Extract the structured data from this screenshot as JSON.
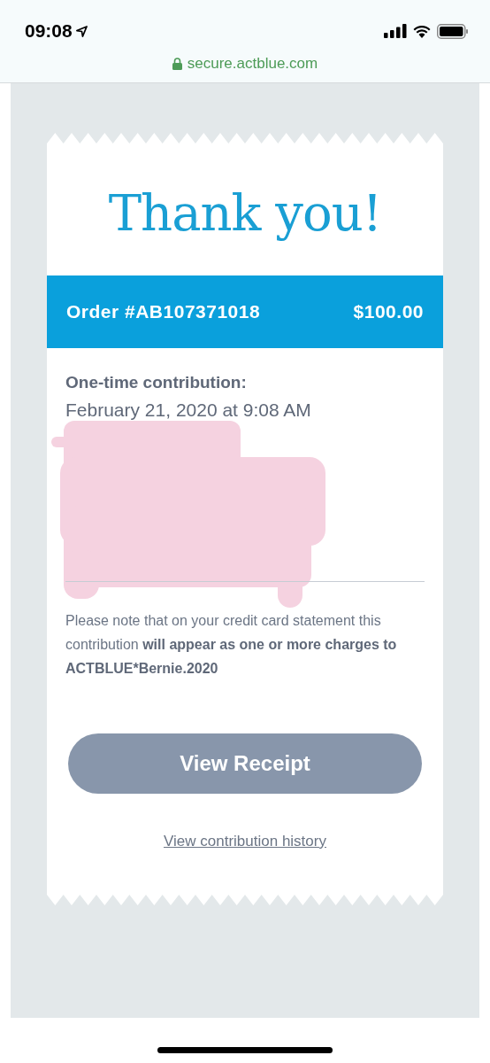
{
  "status_bar": {
    "time": "09:08"
  },
  "address_bar": {
    "url": "secure.actblue.com"
  },
  "receipt": {
    "title": "Thank you!",
    "order_label": "Order #AB107371018",
    "amount": "$100.00",
    "contribution_label": "One-time contribution:",
    "date": "February 21, 2020 at 9:08 AM",
    "redacted": true,
    "note": "Please note that on your credit card statement this contribution **will appear as one or more charges to ACTBLUE*Bernie.2020**",
    "button": "View Receipt",
    "link": "View contribution history"
  }
}
